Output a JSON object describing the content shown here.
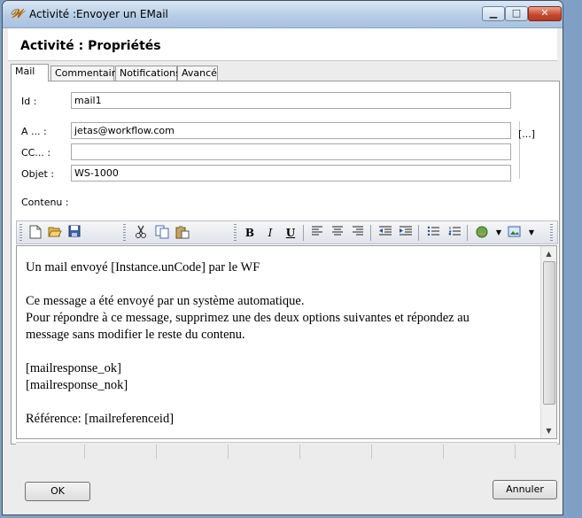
{
  "window": {
    "title": "Activité :Envoyer un EMail",
    "icon": "workflow-app-icon"
  },
  "header": {
    "title": "Activité : Propriétés"
  },
  "tabs": [
    {
      "label": "Mail",
      "active": true
    },
    {
      "label": "Commentaire",
      "active": false
    },
    {
      "label": "Notifications",
      "active": false
    },
    {
      "label": "Avancé",
      "active": false
    }
  ],
  "form": {
    "id_label": "Id :",
    "id_value": "mail1",
    "to_label": "A ... :",
    "to_value": "jetas@workflow.com",
    "cc_label": "CC... :",
    "cc_value": "",
    "subject_label": "Objet :",
    "subject_value": "WS-1000",
    "content_label": "Contenu :",
    "browse_label": "[...]"
  },
  "editor": {
    "lines": [
      "Un mail envoyé [Instance.unCode] par le WF",
      "",
      "Ce message a été envoyé par un système automatique.",
      "Pour répondre à ce message, supprimez une des deux options suivantes et répondez au",
      "message sans modifier le reste du contenu.",
      "",
      "[mailresponse_ok]",
      "[mailresponse_nok]",
      "",
      "Référence: [mailreferenceid]"
    ]
  },
  "toolbar": {
    "new": "new-document-icon",
    "open": "open-folder-icon",
    "save": "save-icon",
    "cut": "cut-icon",
    "copy": "copy-icon",
    "paste": "paste-icon",
    "bold": "B",
    "italic": "I",
    "underline": "U",
    "align_left": "align-left-icon",
    "align_center": "align-center-icon",
    "align_right": "align-right-icon",
    "outdent": "outdent-icon",
    "indent": "indent-icon",
    "bullets": "bullet-list-icon",
    "numbering": "numbered-list-icon",
    "link": "link-icon",
    "image": "insert-image-icon"
  },
  "buttons": {
    "ok": "OK",
    "cancel": "Annuler"
  }
}
